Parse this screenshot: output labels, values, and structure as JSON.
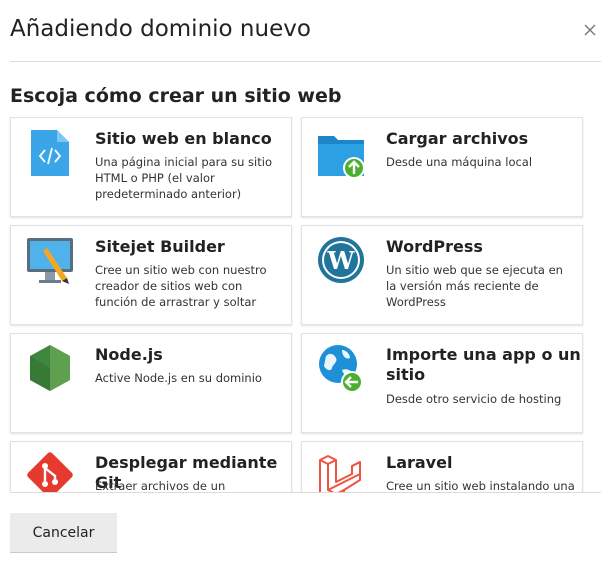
{
  "dialog": {
    "title": "Añadiendo dominio nuevo",
    "subtitle": "Escoja cómo crear un sitio web",
    "cancel_label": "Cancelar"
  },
  "options": [
    {
      "title": "Sitio web en blanco",
      "desc": "Una página inicial para su sitio HTML o PHP (el valor predeterminado anterior)",
      "icon": "blank-file-icon"
    },
    {
      "title": "Cargar archivos",
      "desc": "Desde una máquina local",
      "icon": "upload-folder-icon"
    },
    {
      "title": "Sitejet Builder",
      "desc": "Cree un sitio web con nuestro creador de sitios web con función de arrastrar y soltar",
      "icon": "sitejet-builder-icon"
    },
    {
      "title": "WordPress",
      "desc": "Un sitio web que se ejecuta en la versión más reciente de WordPress",
      "icon": "wordpress-icon"
    },
    {
      "title": "Node.js",
      "desc": "Active Node.js en su dominio",
      "icon": "nodejs-icon"
    },
    {
      "title": "Importe una app o un sitio",
      "desc": "Desde otro servicio de hosting",
      "icon": "import-globe-icon"
    },
    {
      "title": "Desplegar mediante Git",
      "desc": "Extraer archivos de un repositorio Git",
      "icon": "git-icon"
    },
    {
      "title": "Laravel",
      "desc": "Cree un sitio web instalando una aplicación Laravel",
      "icon": "laravel-icon"
    }
  ],
  "colors": {
    "blank_file": "#3aa6e8",
    "folder": "#2d9fe3",
    "upload_badge": "#4caf32",
    "wordpress": "#21759b",
    "nodejs": "#3f873f",
    "globe": "#1e90d8",
    "git": "#e63a2e",
    "laravel": "#f05340"
  }
}
